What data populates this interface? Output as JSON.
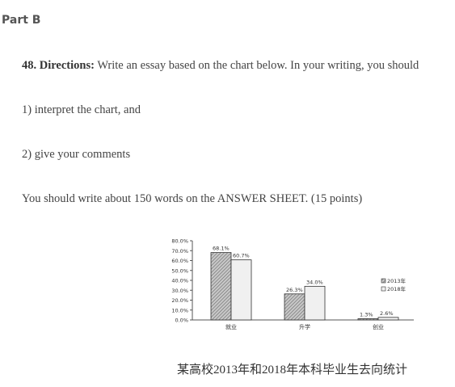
{
  "section_label": "Part B",
  "question": {
    "number_label": "48. Directions:",
    "directions_text": " Write an essay based on the chart below. In your writing, you should",
    "item1": "1) interpret the chart, and",
    "item2": "2) give your comments",
    "word_requirement": "You should write about 150 words on the ANSWER SHEET. (15 points)"
  },
  "caption": "某高校2013年和2018年本科毕业生去向统计",
  "colors": {
    "series_2013": "#a8a8a8",
    "series_2018": "#f0f0f0",
    "stroke": "#333333"
  },
  "chart_data": {
    "type": "bar",
    "categories": [
      "就业",
      "升学",
      "创业"
    ],
    "series": [
      {
        "name": "2013年",
        "values": [
          68.1,
          26.3,
          1.3
        ],
        "labels": [
          "68.1%",
          "26.3%",
          "1.3%"
        ]
      },
      {
        "name": "2018年",
        "values": [
          60.7,
          34.0,
          2.6
        ],
        "labels": [
          "60.7%",
          "34.0%",
          "2.6%"
        ]
      }
    ],
    "yticks": [
      "0.0%",
      "10.0%",
      "20.0%",
      "30.0%",
      "40.0%",
      "50.0%",
      "60.0%",
      "70.0%",
      "80.0%"
    ],
    "ylim": [
      0,
      80
    ],
    "legend": "right",
    "grid": false
  }
}
